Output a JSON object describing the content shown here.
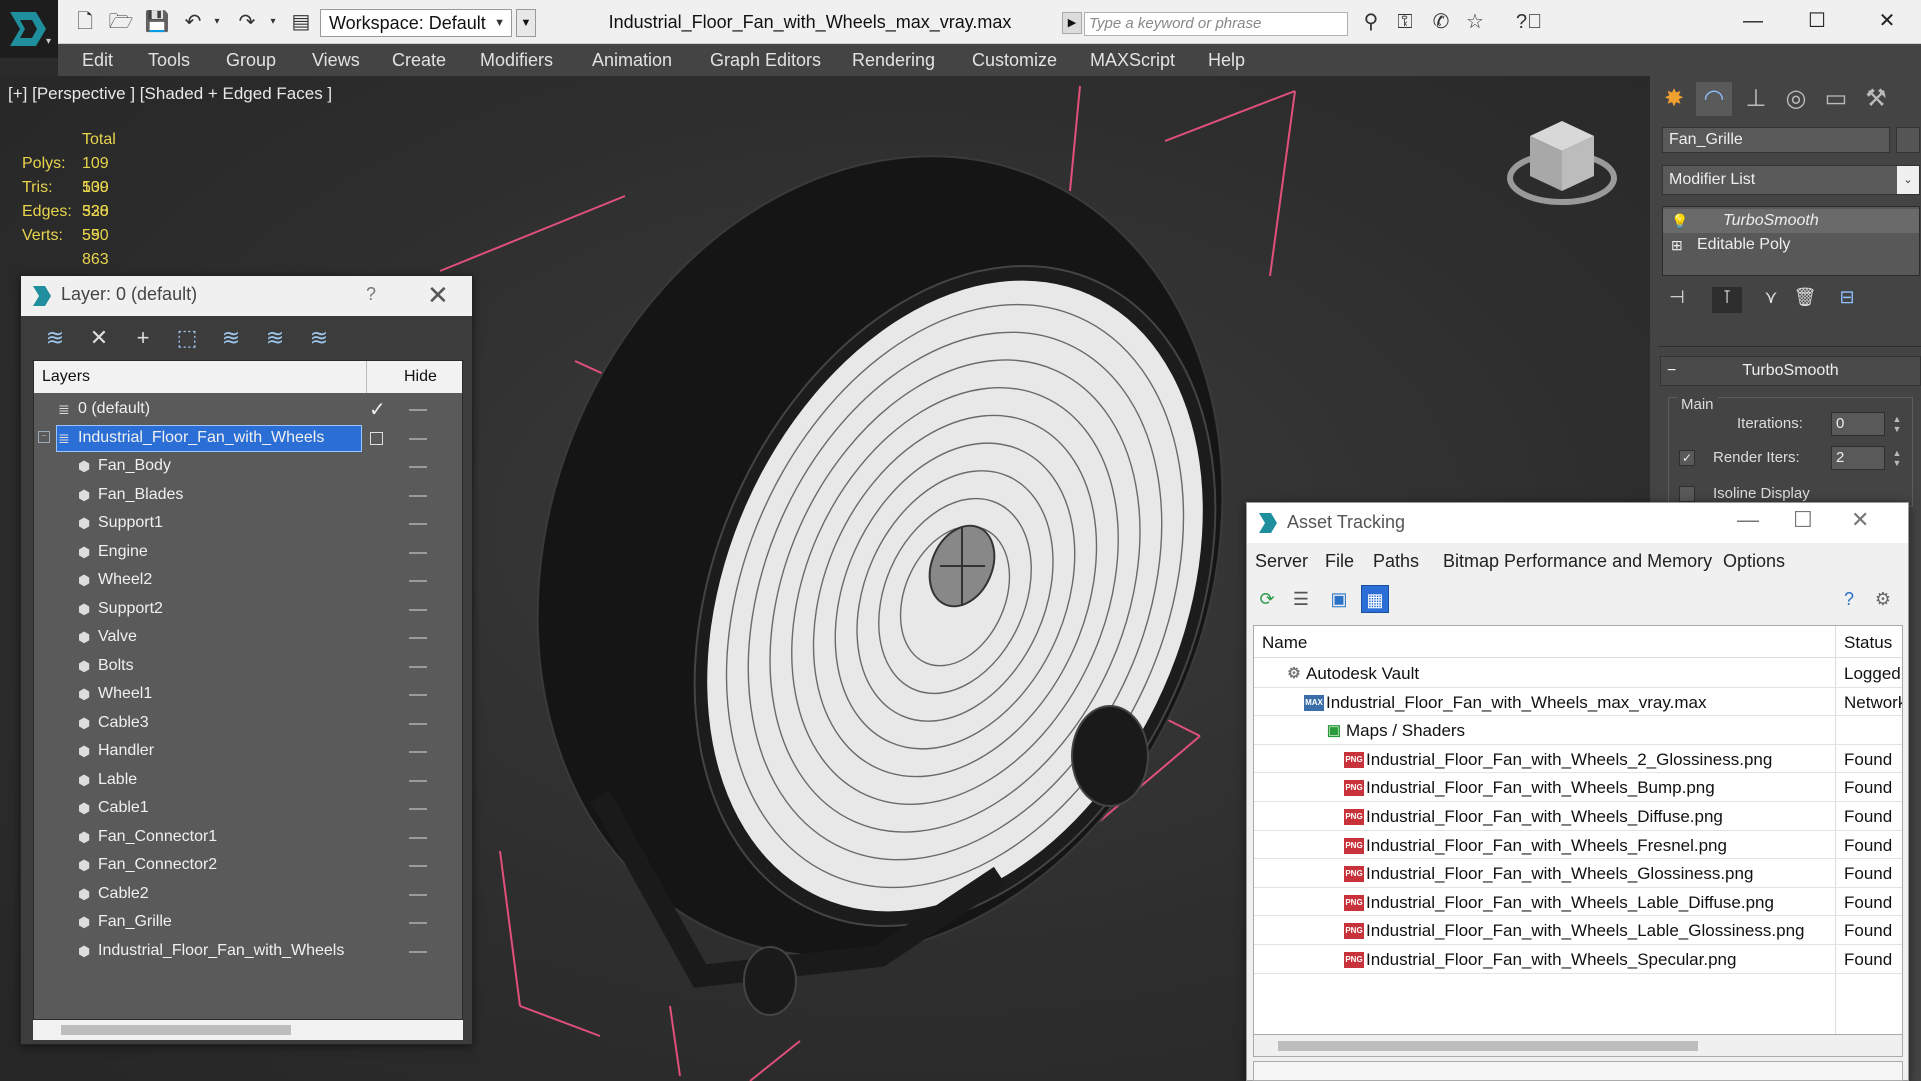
{
  "titlebar": {
    "workspace": "Workspace: Default",
    "document_title": "Industrial_Floor_Fan_with_Wheels_max_vray.max",
    "search_placeholder": "Type a keyword or phrase"
  },
  "menu": [
    "Edit",
    "Tools",
    "Group",
    "Views",
    "Create",
    "Modifiers",
    "Animation",
    "Graph Editors",
    "Rendering",
    "Customize",
    "MAXScript",
    "Help"
  ],
  "viewport": {
    "label": "[+] [Perspective ] [Shaded + Edged Faces ]",
    "stats": {
      "header": "Total",
      "rows": [
        {
          "label": "Polys:",
          "value": "109 530"
        },
        {
          "label": "Tris:",
          "value": "109 530"
        },
        {
          "label": "Edges:",
          "value": "328 590"
        },
        {
          "label": "Verts:",
          "value": "55 863"
        }
      ]
    }
  },
  "layer_dialog": {
    "title": "Layer: 0 (default)",
    "help": "?",
    "col_layers": "Layers",
    "col_hide": "Hide",
    "rows": [
      {
        "name": "0 (default)",
        "level": 0,
        "type": "layer",
        "checked": true
      },
      {
        "name": "Industrial_Floor_Fan_with_Wheels",
        "level": 0,
        "type": "layer",
        "selected": true
      },
      {
        "name": "Fan_Body",
        "level": 1,
        "type": "object"
      },
      {
        "name": "Fan_Blades",
        "level": 1,
        "type": "object"
      },
      {
        "name": "Support1",
        "level": 1,
        "type": "object"
      },
      {
        "name": "Engine",
        "level": 1,
        "type": "object"
      },
      {
        "name": "Wheel2",
        "level": 1,
        "type": "object"
      },
      {
        "name": "Support2",
        "level": 1,
        "type": "object"
      },
      {
        "name": "Valve",
        "level": 1,
        "type": "object"
      },
      {
        "name": "Bolts",
        "level": 1,
        "type": "object"
      },
      {
        "name": "Wheel1",
        "level": 1,
        "type": "object"
      },
      {
        "name": "Cable3",
        "level": 1,
        "type": "object"
      },
      {
        "name": "Handler",
        "level": 1,
        "type": "object"
      },
      {
        "name": "Lable",
        "level": 1,
        "type": "object"
      },
      {
        "name": "Cable1",
        "level": 1,
        "type": "object"
      },
      {
        "name": "Fan_Connector1",
        "level": 1,
        "type": "object"
      },
      {
        "name": "Fan_Connector2",
        "level": 1,
        "type": "object"
      },
      {
        "name": "Cable2",
        "level": 1,
        "type": "object"
      },
      {
        "name": "Fan_Grille",
        "level": 1,
        "type": "object"
      },
      {
        "name": "Industrial_Floor_Fan_with_Wheels",
        "level": 1,
        "type": "object"
      }
    ]
  },
  "command_panel": {
    "object_name": "Fan_Grille",
    "modifier_list": "Modifier List",
    "stack": [
      {
        "name": "TurboSmooth",
        "selected": true
      },
      {
        "name": "Editable Poly",
        "selected": false
      }
    ],
    "rollout_title": "TurboSmooth",
    "group_main": "Main",
    "iterations_label": "Iterations:",
    "iterations_value": "0",
    "render_iters_label": "Render Iters:",
    "render_iters_value": "2",
    "isoline_label": "Isoline Display"
  },
  "asset_tracking": {
    "title": "Asset Tracking",
    "menu": [
      "Server",
      "File",
      "Paths",
      "Bitmap Performance and Memory",
      "Options"
    ],
    "col_name": "Name",
    "col_status": "Status",
    "rows": [
      {
        "name": "Autodesk Vault",
        "level": 0,
        "icon": "vault",
        "status": "Logged O"
      },
      {
        "name": "Industrial_Floor_Fan_with_Wheels_max_vray.max",
        "level": 1,
        "icon": "max",
        "status": "Network"
      },
      {
        "name": "Maps / Shaders",
        "level": 2,
        "icon": "maps",
        "status": ""
      },
      {
        "name": "Industrial_Floor_Fan_with_Wheels_2_Glossiness.png",
        "level": 3,
        "icon": "png",
        "status": "Found"
      },
      {
        "name": "Industrial_Floor_Fan_with_Wheels_Bump.png",
        "level": 3,
        "icon": "png",
        "status": "Found"
      },
      {
        "name": "Industrial_Floor_Fan_with_Wheels_Diffuse.png",
        "level": 3,
        "icon": "png",
        "status": "Found"
      },
      {
        "name": "Industrial_Floor_Fan_with_Wheels_Fresnel.png",
        "level": 3,
        "icon": "png",
        "status": "Found"
      },
      {
        "name": "Industrial_Floor_Fan_with_Wheels_Glossiness.png",
        "level": 3,
        "icon": "png",
        "status": "Found"
      },
      {
        "name": "Industrial_Floor_Fan_with_Wheels_Lable_Diffuse.png",
        "level": 3,
        "icon": "png",
        "status": "Found"
      },
      {
        "name": "Industrial_Floor_Fan_with_Wheels_Lable_Glossiness.png",
        "level": 3,
        "icon": "png",
        "status": "Found"
      },
      {
        "name": "Industrial_Floor_Fan_with_Wheels_Specular.png",
        "level": 3,
        "icon": "png",
        "status": "Found"
      }
    ]
  },
  "colors": {
    "accent_selection": "#2b6fd6",
    "stats_text": "#e8d44d",
    "gizmo_pink": "#e0507a"
  }
}
